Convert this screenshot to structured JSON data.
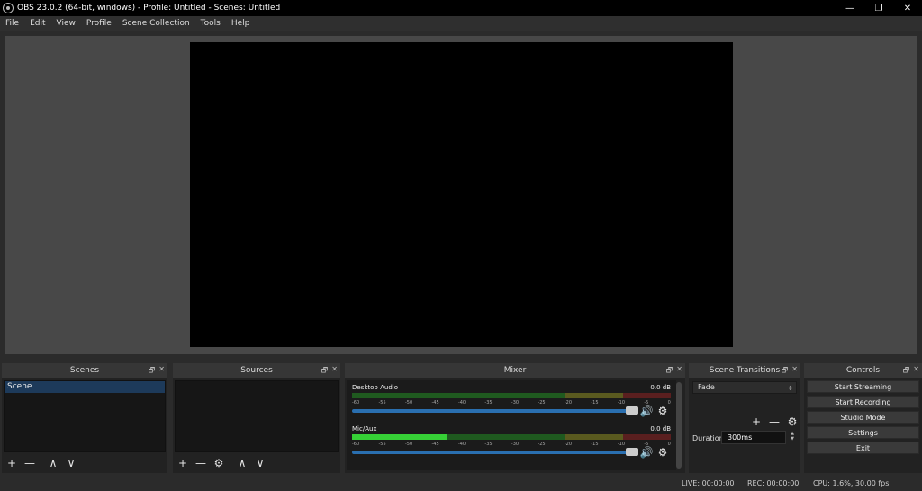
{
  "window": {
    "title": "OBS 23.0.2 (64-bit, windows) - Profile: Untitled - Scenes: Untitled",
    "controls": {
      "minimize": "—",
      "restore": "❐",
      "close": "✕"
    }
  },
  "menu": [
    "File",
    "Edit",
    "View",
    "Profile",
    "Scene Collection",
    "Tools",
    "Help"
  ],
  "docks": {
    "scenes": {
      "title": "Scenes",
      "items": [
        "Scene"
      ]
    },
    "sources": {
      "title": "Sources"
    },
    "mixer": {
      "title": "Mixer",
      "channels": [
        {
          "name": "Desktop Audio",
          "db": "0.0 dB",
          "level": 0.0
        },
        {
          "name": "Mic/Aux",
          "db": "0.0 dB",
          "level": 0.3
        }
      ],
      "ticks": [
        "-60",
        "-55",
        "-50",
        "-45",
        "-40",
        "-35",
        "-30",
        "-25",
        "-20",
        "-15",
        "-10",
        "-5",
        "0"
      ]
    },
    "transitions": {
      "title": "Scene Transitions",
      "selected": "Fade",
      "duration_label": "Duration",
      "duration_value": "300ms"
    },
    "controls": {
      "title": "Controls",
      "buttons": [
        "Start Streaming",
        "Start Recording",
        "Studio Mode",
        "Settings",
        "Exit"
      ]
    }
  },
  "status": {
    "live": "LIVE: 00:00:00",
    "rec": "REC: 00:00:00",
    "cpu": "CPU: 1.6%, 30.00 fps"
  },
  "icons": {
    "add": "+",
    "remove": "—",
    "up": "∧",
    "down": "∨",
    "gear": "⚙",
    "speaker": "🔊",
    "float": "🗗",
    "close": "✕"
  }
}
